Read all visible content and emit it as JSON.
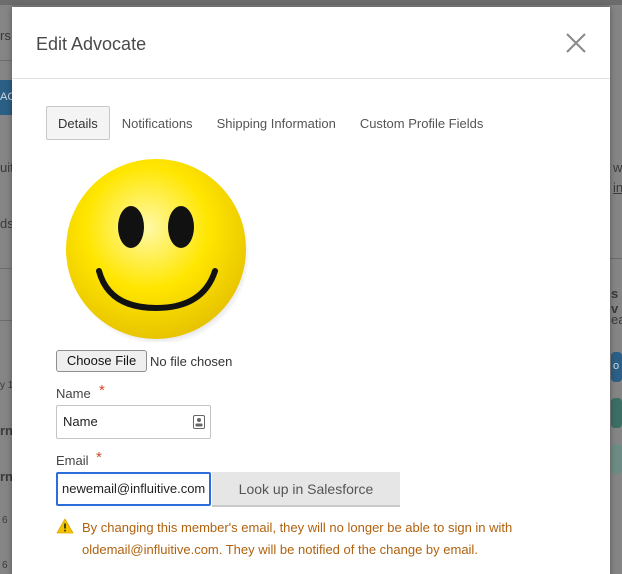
{
  "modal": {
    "title": "Edit Advocate"
  },
  "tabs": [
    {
      "label": "Details",
      "active": true
    },
    {
      "label": "Notifications",
      "active": false
    },
    {
      "label": "Shipping Information",
      "active": false
    },
    {
      "label": "Custom Profile Fields",
      "active": false
    }
  ],
  "avatar": {
    "icon": "smiley-face-icon"
  },
  "file_input": {
    "button_label": "Choose File",
    "status": "No file chosen"
  },
  "name_field": {
    "label": "Name",
    "required_mark": "*",
    "value": "Name"
  },
  "email_field": {
    "label": "Email",
    "required_mark": "*",
    "value": "newemail@influitive.com"
  },
  "lookup_button": {
    "label": "Look up in Salesforce"
  },
  "warning": {
    "text": "By changing this member's email, they will no longer be able to sign in with oldemail@influitive.com. They will be notified of the change by email."
  },
  "background": {
    "fragments": [
      "rs",
      "AC",
      "uit",
      "ds",
      "y 1",
      "rn",
      "rn",
      "6",
      "6",
      "w",
      "in",
      "s v",
      "ea",
      "o"
    ]
  },
  "colors": {
    "accent_focus": "#2a6ddb",
    "required": "#d04a2a",
    "warning_text": "#b0620f",
    "warning_icon": "#f2c200"
  }
}
